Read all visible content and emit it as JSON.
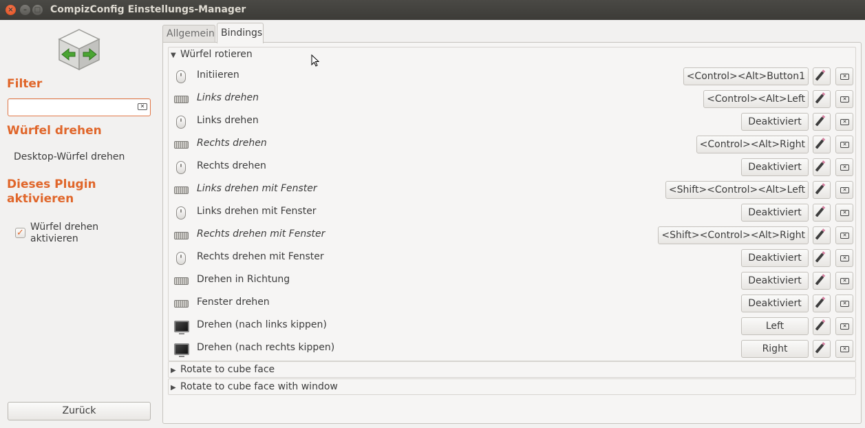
{
  "window": {
    "title": "CompizConfig Einstellungs-Manager"
  },
  "sidebar": {
    "filter_title": "Filter",
    "filter_value": "",
    "group_title": "Würfel drehen",
    "group_link": "Desktop-Würfel drehen",
    "plugin_title": "Dieses Plugin aktivieren",
    "plugin_checkbox_label": "Würfel drehen aktivieren",
    "plugin_checked": true,
    "back_label": "Zurück"
  },
  "tabs": [
    {
      "label": "Allgemein",
      "active": false
    },
    {
      "label": "Bindings",
      "active": true
    }
  ],
  "main": {
    "expanded_group": "Würfel rotieren",
    "rows": [
      {
        "icon": "mouse-icon",
        "label": "Initiieren",
        "italic": false,
        "binding": "<Control><Alt>Button1"
      },
      {
        "icon": "keyboard-icon",
        "label": "Links drehen",
        "italic": true,
        "binding": "<Control><Alt>Left"
      },
      {
        "icon": "mouse-icon",
        "label": "Links drehen",
        "italic": false,
        "binding": "Deaktiviert"
      },
      {
        "icon": "keyboard-icon",
        "label": "Rechts drehen",
        "italic": true,
        "binding": "<Control><Alt>Right"
      },
      {
        "icon": "mouse-icon",
        "label": "Rechts drehen",
        "italic": false,
        "binding": "Deaktiviert"
      },
      {
        "icon": "keyboard-icon",
        "label": "Links drehen mit Fenster",
        "italic": true,
        "binding": "<Shift><Control><Alt>Left"
      },
      {
        "icon": "mouse-icon",
        "label": "Links drehen mit Fenster",
        "italic": false,
        "binding": "Deaktiviert"
      },
      {
        "icon": "keyboard-icon",
        "label": "Rechts drehen mit Fenster",
        "italic": true,
        "binding": "<Shift><Control><Alt>Right"
      },
      {
        "icon": "mouse-icon",
        "label": "Rechts drehen mit Fenster",
        "italic": false,
        "binding": "Deaktiviert"
      },
      {
        "icon": "keyboard-icon",
        "label": "Drehen in Richtung",
        "italic": false,
        "binding": "Deaktiviert"
      },
      {
        "icon": "keyboard-icon",
        "label": "Fenster drehen",
        "italic": false,
        "binding": "Deaktiviert"
      },
      {
        "icon": "screen-edge-icon",
        "label": "Drehen (nach links kippen)",
        "italic": false,
        "binding": "Left"
      },
      {
        "icon": "screen-edge-icon",
        "label": "Drehen (nach rechts kippen)",
        "italic": false,
        "binding": "Right"
      }
    ],
    "collapsed_groups": [
      "Rotate to cube face",
      "Rotate to cube face with window"
    ]
  },
  "colors": {
    "accent": "#e0662a",
    "titlebar": "#3c3b37",
    "window_bg": "#f2f1f0"
  }
}
